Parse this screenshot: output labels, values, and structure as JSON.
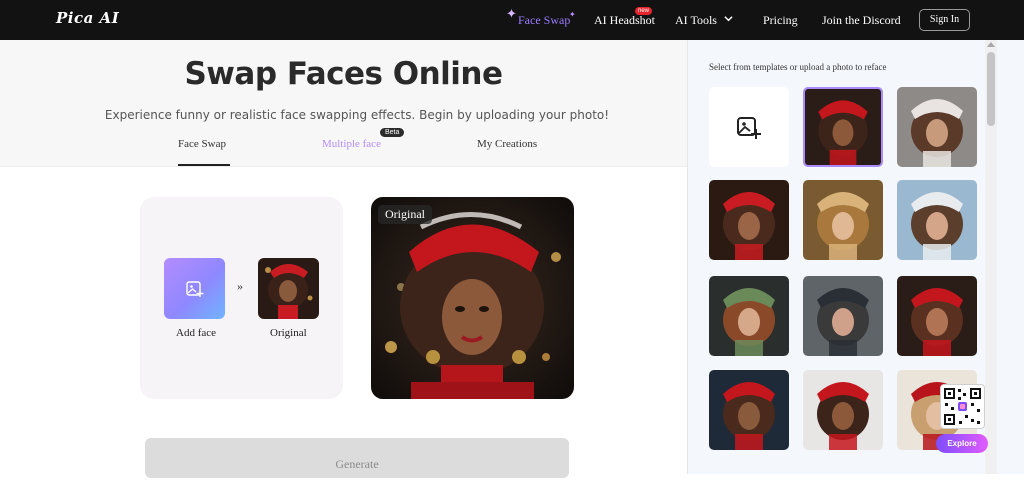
{
  "brand": {
    "logo_text": "Pica AI"
  },
  "nav": {
    "face_swap": "Face Swap",
    "ai_headshot": "AI Headshot",
    "new_badge": "new",
    "ai_tools": "AI Tools",
    "pricing": "Pricing",
    "discord": "Join the Discord",
    "signin": "Sign In"
  },
  "hero": {
    "title": "Swap Faces Online",
    "subtitle": "Experience funny or realistic face swapping effects. Begin by uploading your photo!"
  },
  "tabs": {
    "face_swap": "Face Swap",
    "multiple_face": "Multiple face",
    "beta": "Beta",
    "my_creations": "My Creations"
  },
  "workspace": {
    "add_face_label": "Add face",
    "original_label": "Original",
    "separator": "»",
    "preview_tag": "Original",
    "generate": "Generate"
  },
  "templates": {
    "hint": "Select from templates or upload a photo to reface",
    "items": [
      {
        "name": "upload-photo",
        "icon": "image-plus-icon"
      },
      {
        "name": "template-red-hat-curly",
        "selected": true
      },
      {
        "name": "template-brunette-silver"
      },
      {
        "name": "template-santa-hat-curly"
      },
      {
        "name": "template-blonde-fox"
      },
      {
        "name": "template-horse-white-dress"
      },
      {
        "name": "template-holly-crown"
      },
      {
        "name": "template-captain-hat"
      },
      {
        "name": "template-santa-hat-wavy"
      },
      {
        "name": "template-santa-hat-red-dress"
      },
      {
        "name": "template-santa-hat-scarf"
      },
      {
        "name": "template-santa-hat-blonde"
      }
    ]
  },
  "floating": {
    "explore": "Explore"
  },
  "colors": {
    "topbar": "#121212",
    "accent": "#9b7cff",
    "beta_bg": "#2b2b2b",
    "new_badge": "#e3262e"
  }
}
